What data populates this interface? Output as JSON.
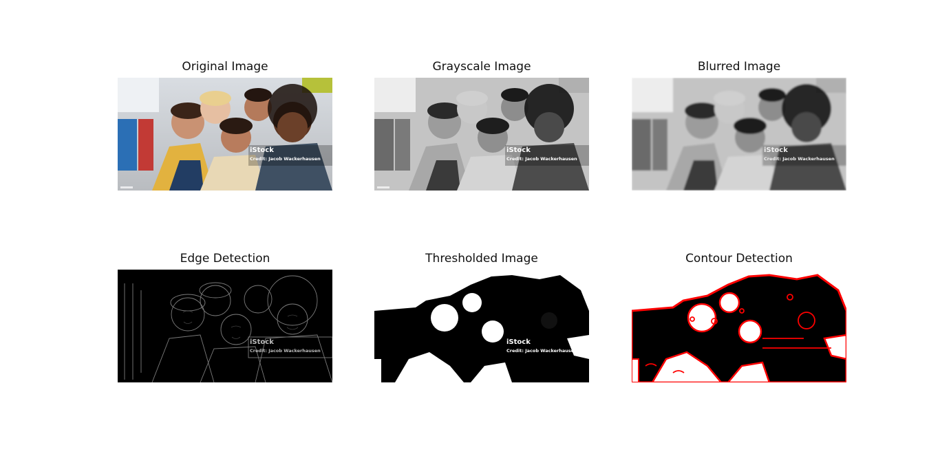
{
  "panels": [
    {
      "title": "Original Image",
      "watermark": {
        "brand": "iStock",
        "credit": "Credit: Jacob Wackerhausen"
      }
    },
    {
      "title": "Grayscale Image",
      "watermark": {
        "brand": "iStock",
        "credit": "Credit: Jacob Wackerhausen"
      }
    },
    {
      "title": "Blurred Image",
      "watermark": {
        "brand": "iStock",
        "credit": "Credit: Jacob Wackerhausen"
      }
    },
    {
      "title": "Edge Detection",
      "watermark": {
        "brand": "iStock",
        "credit": "Credit: Jacob Wackerhausen"
      }
    },
    {
      "title": "Thresholded Image",
      "watermark": {
        "brand": "iStock",
        "credit": "Credit: Jacob Wackerhausen"
      }
    },
    {
      "title": "Contour Detection"
    }
  ],
  "colors": {
    "background": "#ffffff",
    "contour": "#ff0000",
    "threshold_dark": "#000000",
    "threshold_light": "#ffffff"
  }
}
